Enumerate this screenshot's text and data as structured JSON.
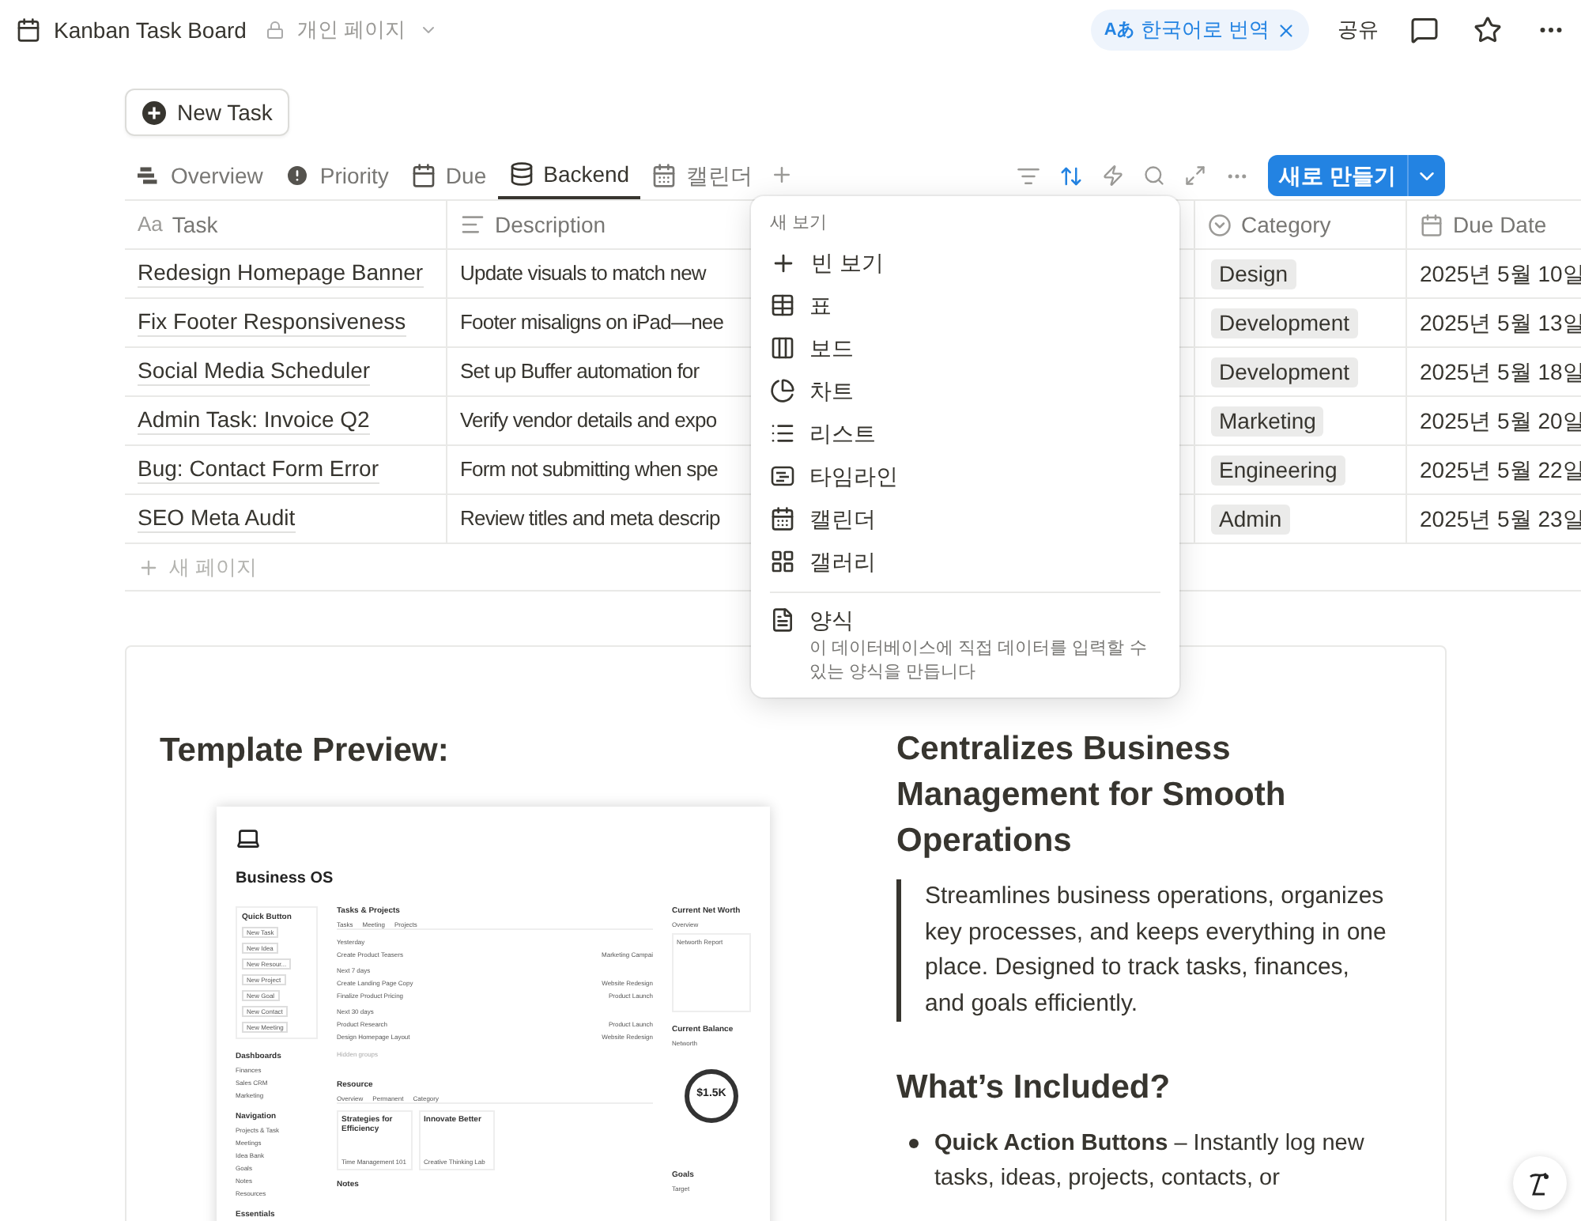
{
  "topbar": {
    "title": "Kanban Task Board",
    "location": "개인 페이지",
    "translate_badge": "Aあ",
    "translate": "한국어로 번역",
    "share": "공유"
  },
  "new_task_button": "New Task",
  "tabs": [
    {
      "label": "Overview",
      "selected": false
    },
    {
      "label": "Priority",
      "selected": false
    },
    {
      "label": "Due",
      "selected": false
    },
    {
      "label": "Backend",
      "selected": true
    },
    {
      "label": "캘린더",
      "selected": false
    }
  ],
  "create_button": "새로 만들기",
  "table": {
    "title_glyph": "Aa",
    "columns": [
      "Task",
      "Description",
      "Category",
      "Due Date"
    ],
    "rows": [
      {
        "task": "Redesign Homepage Banner",
        "description": "Update visuals to match new",
        "category": "Design",
        "due": "2025년 5월 10일"
      },
      {
        "task": "Fix Footer Responsiveness",
        "description": "Footer misaligns on iPad—nee",
        "category": "Development",
        "due": "2025년 5월 13일"
      },
      {
        "task": "Social Media Scheduler",
        "description": "Set up Buffer automation for",
        "category": "Development",
        "due": "2025년 5월 18일"
      },
      {
        "task": "Admin Task: Invoice Q2",
        "description": "Verify vendor details and expo",
        "category": "Marketing",
        "due": "2025년 5월 20일"
      },
      {
        "task": "Bug: Contact Form Error",
        "description": "Form not submitting when spe",
        "category": "Engineering",
        "due": "2025년 5월 22일"
      },
      {
        "task": "SEO Meta Audit",
        "description": "Review titles and meta descrip",
        "category": "Admin",
        "due": "2025년 5월 23일"
      }
    ],
    "new_row": "새 페이지"
  },
  "menu": {
    "heading": "새 보기",
    "items": [
      "빈 보기",
      "표",
      "보드",
      "차트",
      "리스트",
      "타임라인",
      "캘린더",
      "갤러리"
    ],
    "form": {
      "label": "양식",
      "description": "이 데이터베이스에 직접 데이터를 입력할 수 있는 양식을 만듭니다"
    }
  },
  "content": {
    "preview_heading": "Template Preview:",
    "preview": {
      "title": "Business OS",
      "quick_heading": "Quick Button",
      "quick": [
        "New Task",
        "New Idea",
        "New Resour...",
        "New Project",
        "New Goal",
        "New Contact",
        "New Meeting"
      ],
      "dash_heading": "Dashboards",
      "dash": [
        "Finances",
        "Sales CRM",
        "Marketing"
      ],
      "nav_heading": "Navigation",
      "nav": [
        "Projects & Task",
        "Meetings",
        "Idea Bank",
        "Goals",
        "Notes",
        "Resources"
      ],
      "essentials": "Essentials",
      "tasks_heading": "Tasks & Projects",
      "task_tabs": [
        "Tasks",
        "Meeting",
        "Projects"
      ],
      "groups": [
        {
          "label": "Yesterday",
          "rows": [
            {
              "name": "Create Product Teasers",
              "project": "Marketing Campai"
            }
          ]
        },
        {
          "label": "Next 7 days",
          "rows": [
            {
              "name": "Create Landing Page Copy",
              "project": "Website Redesign"
            },
            {
              "name": "Finalize Product Pricing",
              "project": "Product Launch"
            }
          ]
        },
        {
          "label": "Next 30 days",
          "rows": [
            {
              "name": "Product Research",
              "project": "Product Launch"
            },
            {
              "name": "Design Homepage Layout",
              "project": "Website Redesign"
            }
          ]
        }
      ],
      "hidden_groups": "Hidden groups",
      "resource_heading": "Resource",
      "resource_tabs": [
        "Overview",
        "Permanent",
        "Category"
      ],
      "cards": [
        {
          "title": "Strategies for Efficiency",
          "footer": "Time Management 101"
        },
        {
          "title": "Innovate Better",
          "footer": "Creative Thinking Lab"
        }
      ],
      "notes_heading": "Notes",
      "networth_heading": "Current Net Worth",
      "networth_tab": "Overview",
      "report_title": "Networth Report",
      "balance_heading": "Current Balance",
      "balance_tab": "Networth",
      "balance": "$1.5K",
      "goals_heading": "Goals",
      "goals_tab": "Target"
    },
    "heading": "Centralizes Business Management for Smooth Operations",
    "quote": "Streamlines business operations, organizes key processes, and keeps everything in one place. Designed to track tasks, finances, and goals efficiently.",
    "included_heading": "What’s Included?",
    "bullets": [
      "**Quick Action Buttons** – Instantly log new tasks, ideas, projects, contacts, or"
    ]
  }
}
